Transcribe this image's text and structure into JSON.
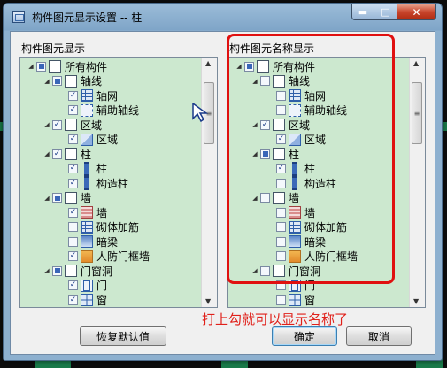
{
  "window": {
    "title": "构件图元显示设置 -- 柱",
    "controls": {
      "minimize": "▬",
      "maximize": "□",
      "close": "✕"
    }
  },
  "left_panel": {
    "title": "构件图元显示",
    "items": [
      {
        "label": "所有构件",
        "level": 0,
        "check": "part",
        "icon": "doc",
        "expand": "◢"
      },
      {
        "label": "轴线",
        "level": 1,
        "check": "part",
        "icon": "doc",
        "expand": "◢"
      },
      {
        "label": "轴网",
        "level": 2,
        "check": "checked",
        "icon": "grid",
        "expand": ""
      },
      {
        "label": "辅助轴线",
        "level": 2,
        "check": "checked",
        "icon": "aux",
        "expand": ""
      },
      {
        "label": "区域",
        "level": 1,
        "check": "checked",
        "icon": "doc",
        "expand": "◢"
      },
      {
        "label": "区域",
        "level": 2,
        "check": "checked",
        "icon": "region",
        "expand": ""
      },
      {
        "label": "柱",
        "level": 1,
        "check": "checked",
        "icon": "doc",
        "expand": "◢"
      },
      {
        "label": "柱",
        "level": 2,
        "check": "checked",
        "icon": "col",
        "expand": ""
      },
      {
        "label": "构造柱",
        "level": 2,
        "check": "checked",
        "icon": "col",
        "expand": ""
      },
      {
        "label": "墙",
        "level": 1,
        "check": "part",
        "icon": "doc",
        "expand": "◢"
      },
      {
        "label": "墙",
        "level": 2,
        "check": "checked",
        "icon": "wall",
        "expand": ""
      },
      {
        "label": "砌体加筋",
        "level": 2,
        "check": "none",
        "icon": "grid",
        "expand": ""
      },
      {
        "label": "暗梁",
        "level": 2,
        "check": "none",
        "icon": "beam",
        "expand": ""
      },
      {
        "label": "人防门框墙",
        "level": 2,
        "check": "checked",
        "icon": "civ",
        "expand": ""
      },
      {
        "label": "门窗洞",
        "level": 1,
        "check": "part",
        "icon": "doc",
        "expand": "◢"
      },
      {
        "label": "门",
        "level": 2,
        "check": "checked",
        "icon": "door",
        "expand": ""
      },
      {
        "label": "窗",
        "level": 2,
        "check": "checked",
        "icon": "win",
        "expand": ""
      }
    ]
  },
  "right_panel": {
    "title": "构件图元名称显示",
    "items": [
      {
        "label": "所有构件",
        "level": 0,
        "check": "part",
        "icon": "doc",
        "expand": "◢"
      },
      {
        "label": "轴线",
        "level": 1,
        "check": "none",
        "icon": "doc",
        "expand": "◢"
      },
      {
        "label": "轴网",
        "level": 2,
        "check": "none",
        "icon": "grid",
        "expand": ""
      },
      {
        "label": "辅助轴线",
        "level": 2,
        "check": "none",
        "icon": "aux",
        "expand": ""
      },
      {
        "label": "区域",
        "level": 1,
        "check": "checked",
        "icon": "doc",
        "expand": "◢"
      },
      {
        "label": "区域",
        "level": 2,
        "check": "checked",
        "icon": "region",
        "expand": ""
      },
      {
        "label": "柱",
        "level": 1,
        "check": "part",
        "icon": "doc",
        "expand": "◢"
      },
      {
        "label": "柱",
        "level": 2,
        "check": "checked",
        "icon": "col",
        "expand": ""
      },
      {
        "label": "构造柱",
        "level": 2,
        "check": "none",
        "icon": "col",
        "expand": ""
      },
      {
        "label": "墙",
        "level": 1,
        "check": "none",
        "icon": "doc",
        "expand": "◢"
      },
      {
        "label": "墙",
        "level": 2,
        "check": "none",
        "icon": "wall",
        "expand": ""
      },
      {
        "label": "砌体加筋",
        "level": 2,
        "check": "none",
        "icon": "grid",
        "expand": ""
      },
      {
        "label": "暗梁",
        "level": 2,
        "check": "none",
        "icon": "beam",
        "expand": ""
      },
      {
        "label": "人防门框墙",
        "level": 2,
        "check": "none",
        "icon": "civ",
        "expand": ""
      },
      {
        "label": "门窗洞",
        "level": 1,
        "check": "none",
        "icon": "doc",
        "expand": "◢"
      },
      {
        "label": "门",
        "level": 2,
        "check": "none",
        "icon": "door",
        "expand": ""
      },
      {
        "label": "窗",
        "level": 2,
        "check": "none",
        "icon": "win",
        "expand": ""
      }
    ]
  },
  "scrollbar": {
    "up": "▲",
    "down": "▼",
    "grip": "≡"
  },
  "buttons": {
    "restore_default": "恢复默认值",
    "ok": "确定",
    "cancel": "取消"
  },
  "annotation": "打上勾就可以显示名称了",
  "colors": {
    "tree_bg": "#cce8cf",
    "highlight": "#e01010",
    "annotation": "#e0201a"
  }
}
